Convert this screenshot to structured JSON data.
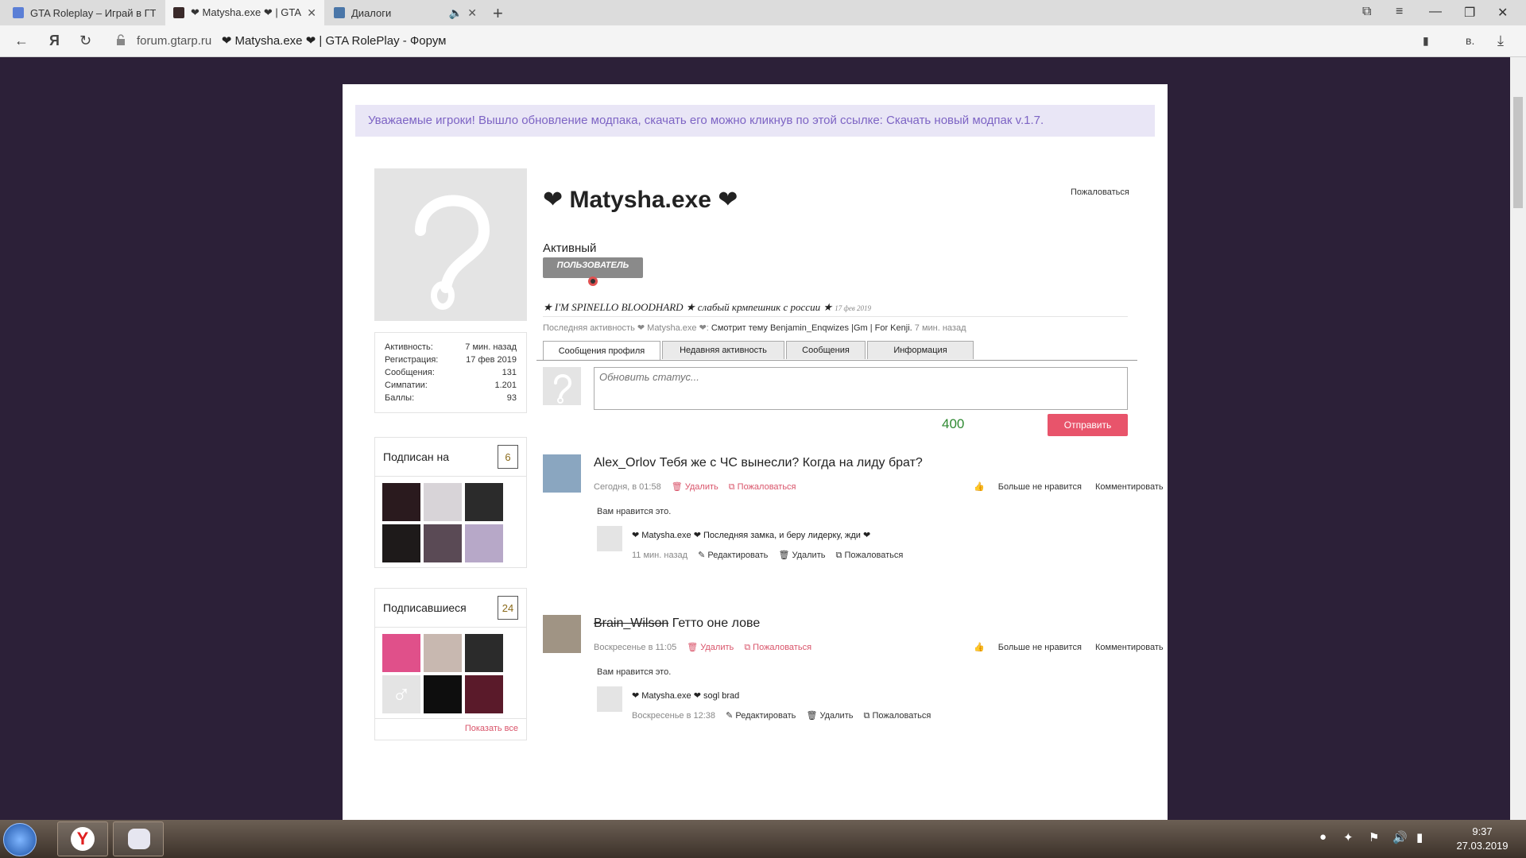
{
  "browser": {
    "tabs": [
      {
        "title": "GTA Roleplay – Играй в ГТА",
        "active": false
      },
      {
        "title": "❤ Matysha.exe ❤ | GTA RolePlay",
        "active": true
      },
      {
        "title": "Диалоги",
        "active": false
      }
    ],
    "url_domain": "forum.gtarp.ru",
    "url_title": "❤ Matysha.exe ❤ | GTA RolePlay - Форум",
    "yandex_letter": "Я"
  },
  "notice": {
    "text": "Уважаемые игроки! Вышло обновление модпака, скачать его можно кликнув по этой ссылке: Скачать новый модпак v.1.7."
  },
  "profile": {
    "name": "❤ Matysha.exe ❤",
    "report_label": "Пожаловаться",
    "status_word": "Активный",
    "badge": "ПОЛЬЗОВАТЕЛЬ",
    "signature": {
      "text": "★ I'M SPINELLO BLOODHARD ★ слабый крмпешник с россии ★",
      "date": "17 фев 2019"
    },
    "last_activity": {
      "label": "Последняя активность ❤ Matysha.exe ❤:",
      "action": "Смотрит тему Benjamin_Enqwizes |Gm | For Kenji.",
      "time": "7 мин. назад"
    },
    "stats": [
      {
        "label": "Активность:",
        "value": "7 мин. назад"
      },
      {
        "label": "Регистрация:",
        "value": "17 фев 2019"
      },
      {
        "label": "Сообщения:",
        "value": "131"
      },
      {
        "label": "Симпатии:",
        "value": "1.201"
      },
      {
        "label": "Баллы:",
        "value": "93"
      }
    ],
    "following": {
      "title": "Подписан на",
      "count": "6"
    },
    "followers": {
      "title": "Подписавшиеся",
      "count": "24",
      "show_all": "Показать все"
    }
  },
  "profile_tabs": [
    {
      "label": "Сообщения профиля",
      "active": true
    },
    {
      "label": "Недавняя активность",
      "active": false
    },
    {
      "label": "Сообщения",
      "active": false
    },
    {
      "label": "Информация",
      "active": false
    }
  ],
  "status_box": {
    "placeholder": "Обновить статус...",
    "counter": "400",
    "send_label": "Отправить"
  },
  "posts": [
    {
      "author": "Alex_Orlov",
      "text": "Тебя же с ЧС вынесли? Когда на лиду брат?",
      "time": "Сегодня, в 01:58",
      "delete": "Удалить",
      "report": "Пожаловаться",
      "unlike": "Больше не нравится",
      "comment_action": "Комментировать",
      "likes": "Вам нравится это.",
      "comment": {
        "author": "❤ Matysha.exe ❤",
        "text": "Последняя замка, и беру лидерку, жди ❤",
        "time": "11 мин. назад",
        "edit": "Редактировать",
        "delete": "Удалить",
        "report": "Пожаловаться"
      }
    },
    {
      "author": "Brain_Wilson",
      "text": "Гетто оне лове",
      "time": "Воскресенье в 11:05",
      "delete": "Удалить",
      "report": "Пожаловаться",
      "unlike": "Больше не нравится",
      "comment_action": "Комментировать",
      "likes": "Вам нравится это.",
      "comment": {
        "author": "❤ Matysha.exe ❤",
        "text": "sogl brad",
        "time": "Воскресенье в 12:38",
        "edit": "Редактировать",
        "delete": "Удалить",
        "report": "Пожаловаться"
      }
    }
  ],
  "taskbar": {
    "time": "9:37",
    "date": "27.03.2019"
  },
  "colors": {
    "page_bg": "#2c2038",
    "accent_red": "#e8546b",
    "notice_text": "#7d64c4",
    "counter_green": "#2f8a32"
  }
}
